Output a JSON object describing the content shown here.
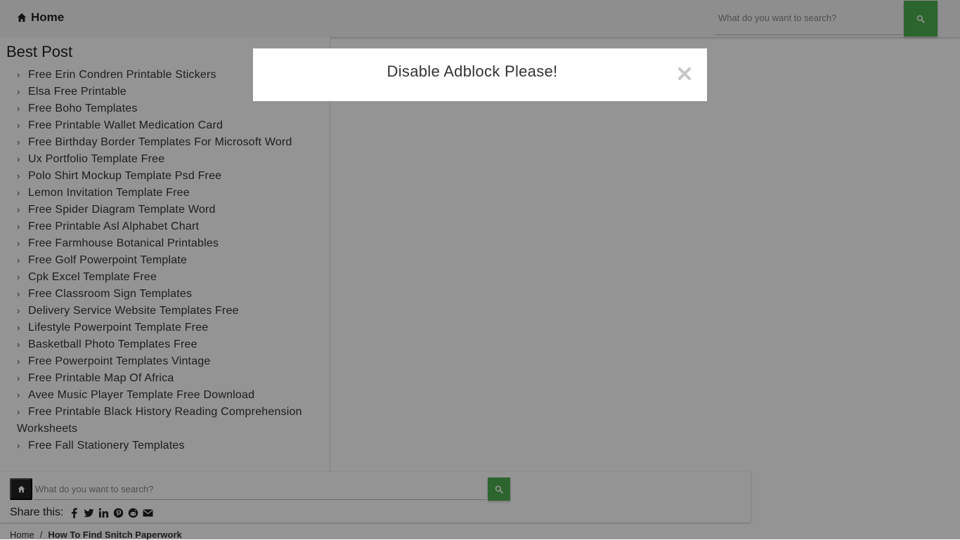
{
  "header": {
    "home_label": "Home",
    "search_placeholder": "What do you want to search?"
  },
  "sidebar": {
    "title": "Best Post",
    "items": [
      "Free Erin Condren Printable Stickers",
      "Elsa Free Printable",
      "Free Boho Templates",
      "Free Printable Wallet Medication Card",
      "Free Birthday Border Templates For Microsoft Word",
      "Ux Portfolio Template Free",
      "Polo Shirt Mockup Template Psd Free",
      "Lemon Invitation Template Free",
      "Free Spider Diagram Template Word",
      "Free Printable Asl Alphabet Chart",
      "Free Farmhouse Botanical Printables",
      "Free Golf Powerpoint Template",
      "Cpk Excel Template Free",
      "Free Classroom Sign Templates",
      "Delivery Service Website Templates Free",
      "Lifestyle Powerpoint Template Free",
      "Basketball Photo Templates Free",
      "Free Powerpoint Templates Vintage",
      "Free Printable Map Of Africa",
      "Avee Music Player Template Free Download",
      "Free Printable Black History Reading Comprehension Worksheets",
      "Free Fall Stationery Templates"
    ]
  },
  "bottom_search": {
    "placeholder": "What do you want to search?"
  },
  "share": {
    "label": "Share this:",
    "icons": [
      "facebook-icon",
      "twitter-icon",
      "linkedin-icon",
      "pinterest-icon",
      "reddit-icon",
      "email-icon"
    ]
  },
  "breadcrumb": {
    "home": "Home",
    "separator": "/",
    "current": "How To Find Snitch Paperwork"
  },
  "modal": {
    "title": "Disable Adblock Please!"
  },
  "colors": {
    "accent_green": "#4caf50",
    "dark_button": "#222222",
    "overlay": "rgba(0,0,0,0.42)"
  }
}
